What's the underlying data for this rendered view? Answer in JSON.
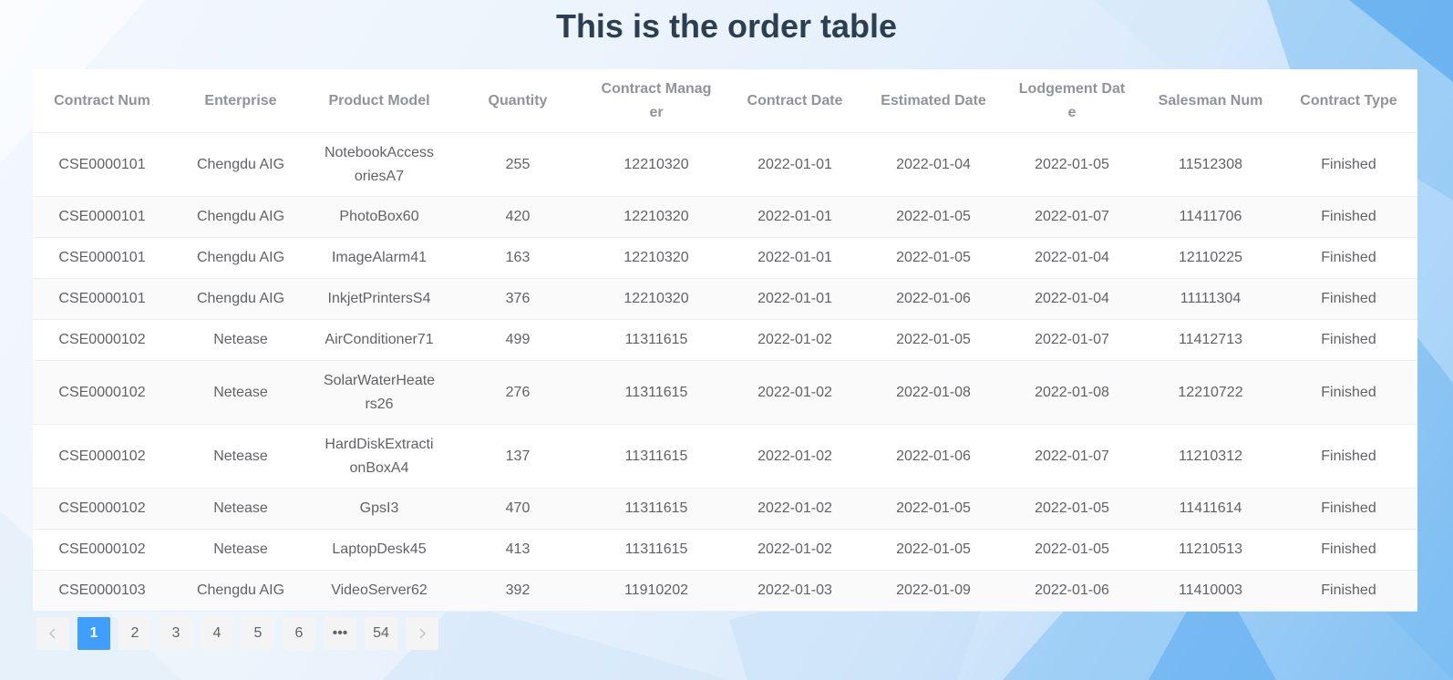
{
  "page": {
    "title": "This is the order table"
  },
  "table": {
    "columns": [
      "Contract Num",
      "Enterprise",
      "Product Model",
      "Quantity",
      "Contract Manag er",
      "Contract Date",
      "Estimated Date",
      "Lodgement Date",
      "Salesman Num",
      "Contract Type"
    ],
    "rows": [
      [
        "CSE0000101",
        "Chengdu AIG",
        "NotebookAccess oriesA7",
        "255",
        "12210320",
        "2022-01-01",
        "2022-01-04",
        "2022-01-05",
        "11512308",
        "Finished"
      ],
      [
        "CSE0000101",
        "Chengdu AIG",
        "PhotoBox60",
        "420",
        "12210320",
        "2022-01-01",
        "2022-01-05",
        "2022-01-07",
        "11411706",
        "Finished"
      ],
      [
        "CSE0000101",
        "Chengdu AIG",
        "ImageAlarm41",
        "163",
        "12210320",
        "2022-01-01",
        "2022-01-05",
        "2022-01-04",
        "12110225",
        "Finished"
      ],
      [
        "CSE0000101",
        "Chengdu AIG",
        "InkjetPrintersS4",
        "376",
        "12210320",
        "2022-01-01",
        "2022-01-06",
        "2022-01-04",
        "11111304",
        "Finished"
      ],
      [
        "CSE0000102",
        "Netease",
        "AirConditioner71",
        "499",
        "11311615",
        "2022-01-02",
        "2022-01-05",
        "2022-01-07",
        "11412713",
        "Finished"
      ],
      [
        "CSE0000102",
        "Netease",
        "SolarWaterHeate rs26",
        "276",
        "11311615",
        "2022-01-02",
        "2022-01-08",
        "2022-01-08",
        "12210722",
        "Finished"
      ],
      [
        "CSE0000102",
        "Netease",
        "HardDiskExtracti onBoxA4",
        "137",
        "11311615",
        "2022-01-02",
        "2022-01-06",
        "2022-01-07",
        "11210312",
        "Finished"
      ],
      [
        "CSE0000102",
        "Netease",
        "GpsI3",
        "470",
        "11311615",
        "2022-01-02",
        "2022-01-05",
        "2022-01-05",
        "11411614",
        "Finished"
      ],
      [
        "CSE0000102",
        "Netease",
        "LaptopDesk45",
        "413",
        "11311615",
        "2022-01-02",
        "2022-01-05",
        "2022-01-05",
        "11210513",
        "Finished"
      ],
      [
        "CSE0000103",
        "Chengdu AIG",
        "VideoServer62",
        "392",
        "11910202",
        "2022-01-03",
        "2022-01-09",
        "2022-01-06",
        "11410003",
        "Finished"
      ]
    ]
  },
  "pagination": {
    "prev_icon": "chevron-left-icon",
    "next_icon": "chevron-right-icon",
    "pages": [
      "1",
      "2",
      "3",
      "4",
      "5",
      "6",
      "•••",
      "54"
    ],
    "current": "1"
  },
  "colors": {
    "accent": "#409eff",
    "title": "#2c3e50",
    "header_text": "#909399",
    "cell_text": "#606266"
  }
}
